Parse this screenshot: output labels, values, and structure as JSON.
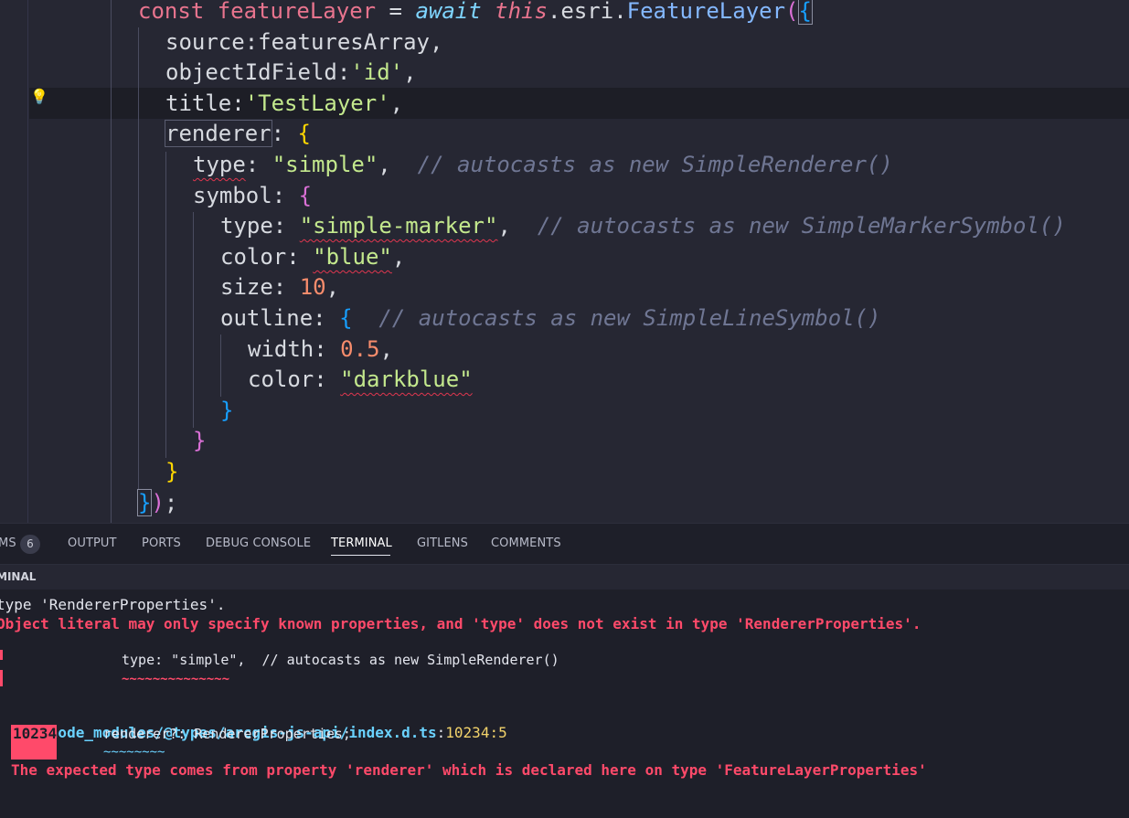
{
  "editor": {
    "lines": [
      {
        "parts": [
          {
            "t": "const ",
            "c": "tok-kw"
          },
          {
            "t": "featureLayer",
            "c": "tok-var"
          },
          {
            "t": " = ",
            "c": "tok-punct"
          },
          {
            "t": "await",
            "c": "tok-ital"
          },
          {
            "t": " ",
            "c": "tok-punct"
          },
          {
            "t": "this",
            "c": "tok-this"
          },
          {
            "t": ".esri.",
            "c": "tok-punct"
          },
          {
            "t": "FeatureLayer",
            "c": "tok-fn"
          },
          {
            "t": "(",
            "c": "tok-b2"
          },
          {
            "t": "{",
            "c": "tok-b3 bracket-box"
          }
        ]
      },
      {
        "parts": [
          {
            "t": "source",
            "c": "tok-punct"
          },
          {
            "t": ":",
            "c": "tok-punct"
          },
          {
            "t": "featuresArray",
            "c": "tok-punct"
          },
          {
            "t": ",",
            "c": "tok-punct"
          }
        ]
      },
      {
        "parts": [
          {
            "t": "objectIdField",
            "c": "tok-punct"
          },
          {
            "t": ":",
            "c": "tok-punct"
          },
          {
            "t": "'id'",
            "c": "tok-str"
          },
          {
            "t": ",",
            "c": "tok-punct"
          }
        ]
      },
      {
        "parts": [
          {
            "t": "title",
            "c": "tok-punct"
          },
          {
            "t": ":",
            "c": "tok-punct"
          },
          {
            "t": "'TestLayer'",
            "c": "tok-str"
          },
          {
            "t": ",",
            "c": "tok-punct"
          }
        ]
      },
      {
        "parts": [
          {
            "t": "renderer",
            "c": "tok-punct boxed"
          },
          {
            "t": ": ",
            "c": "tok-punct"
          },
          {
            "t": "{",
            "c": "tok-b1"
          }
        ]
      },
      {
        "parts": [
          {
            "t": "type",
            "c": "tok-punct squig"
          },
          {
            "t": ": ",
            "c": "tok-punct"
          },
          {
            "t": "\"simple\"",
            "c": "tok-str"
          },
          {
            "t": ",  ",
            "c": "tok-punct"
          },
          {
            "t": "// autocasts as new SimpleRenderer()",
            "c": "tok-com"
          }
        ]
      },
      {
        "parts": [
          {
            "t": "symbol",
            "c": "tok-punct"
          },
          {
            "t": ": ",
            "c": "tok-punct"
          },
          {
            "t": "{",
            "c": "tok-b2"
          }
        ]
      },
      {
        "parts": [
          {
            "t": "type",
            "c": "tok-punct"
          },
          {
            "t": ": ",
            "c": "tok-punct"
          },
          {
            "t": "\"simple-marker\"",
            "c": "tok-str squig"
          },
          {
            "t": ",  ",
            "c": "tok-punct"
          },
          {
            "t": "// autocasts as new SimpleMarkerSymbol()",
            "c": "tok-com"
          }
        ]
      },
      {
        "parts": [
          {
            "t": "color",
            "c": "tok-punct"
          },
          {
            "t": ": ",
            "c": "tok-punct"
          },
          {
            "t": "\"blue\"",
            "c": "tok-str squig"
          },
          {
            "t": ",",
            "c": "tok-punct"
          }
        ]
      },
      {
        "parts": [
          {
            "t": "size",
            "c": "tok-punct"
          },
          {
            "t": ": ",
            "c": "tok-punct"
          },
          {
            "t": "10",
            "c": "tok-num"
          },
          {
            "t": ",",
            "c": "tok-punct"
          }
        ]
      },
      {
        "parts": [
          {
            "t": "outline",
            "c": "tok-punct"
          },
          {
            "t": ": ",
            "c": "tok-punct"
          },
          {
            "t": "{",
            "c": "tok-b3"
          },
          {
            "t": "  ",
            "c": "tok-punct"
          },
          {
            "t": "// autocasts as new SimpleLineSymbol()",
            "c": "tok-com"
          }
        ]
      },
      {
        "parts": [
          {
            "t": "width",
            "c": "tok-punct"
          },
          {
            "t": ": ",
            "c": "tok-punct"
          },
          {
            "t": "0.5",
            "c": "tok-num"
          },
          {
            "t": ",",
            "c": "tok-punct"
          }
        ]
      },
      {
        "parts": [
          {
            "t": "color",
            "c": "tok-punct"
          },
          {
            "t": ": ",
            "c": "tok-punct"
          },
          {
            "t": "\"darkblue\"",
            "c": "tok-str squig"
          }
        ]
      },
      {
        "parts": [
          {
            "t": "}",
            "c": "tok-b3"
          }
        ]
      },
      {
        "parts": [
          {
            "t": "}",
            "c": "tok-b2"
          }
        ]
      },
      {
        "parts": [
          {
            "t": "}",
            "c": "tok-b1"
          }
        ]
      },
      {
        "parts": [
          {
            "t": "}",
            "c": "tok-b3 bracket-box"
          },
          {
            "t": ")",
            "c": "tok-b2"
          },
          {
            "t": ";",
            "c": "tok-punct"
          }
        ]
      }
    ]
  },
  "panel": {
    "tabs": {
      "problems": "MS",
      "problems_count": "6",
      "output": "OUTPUT",
      "ports": "PORTS",
      "debug_console": "DEBUG CONSOLE",
      "terminal": "TERMINAL",
      "gitlens": "GITLENS",
      "comments": "COMMENTS"
    },
    "header": "MINAL"
  },
  "terminal": {
    "line1": "type 'RendererProperties'.",
    "line2": "Object literal may only specify known properties, and 'type' does not exist in type 'RendererProperties'.",
    "code_snippet": "type: \"simple\",  // autocasts as new SimpleRenderer()",
    "squiggle1": "~~~~~~~~~~~~~~",
    "path": "node_modules/@types/arcgis-js-api/index.d.ts",
    "path_sep": ":",
    "location": "10234:5",
    "line_no": "10234",
    "decl": "renderer?: RendererProperties;",
    "squiggle2": "~~~~~~~~",
    "related": "The expected type comes from property 'renderer' which is declared here on type 'FeatureLayerProperties'"
  },
  "colors": {
    "editor_bg": "#262733",
    "panel_bg": "#1e1f29",
    "error_red": "#ff4a6a",
    "path_cyan": "#6ad2ff",
    "location_yellow": "#f3d36b"
  }
}
